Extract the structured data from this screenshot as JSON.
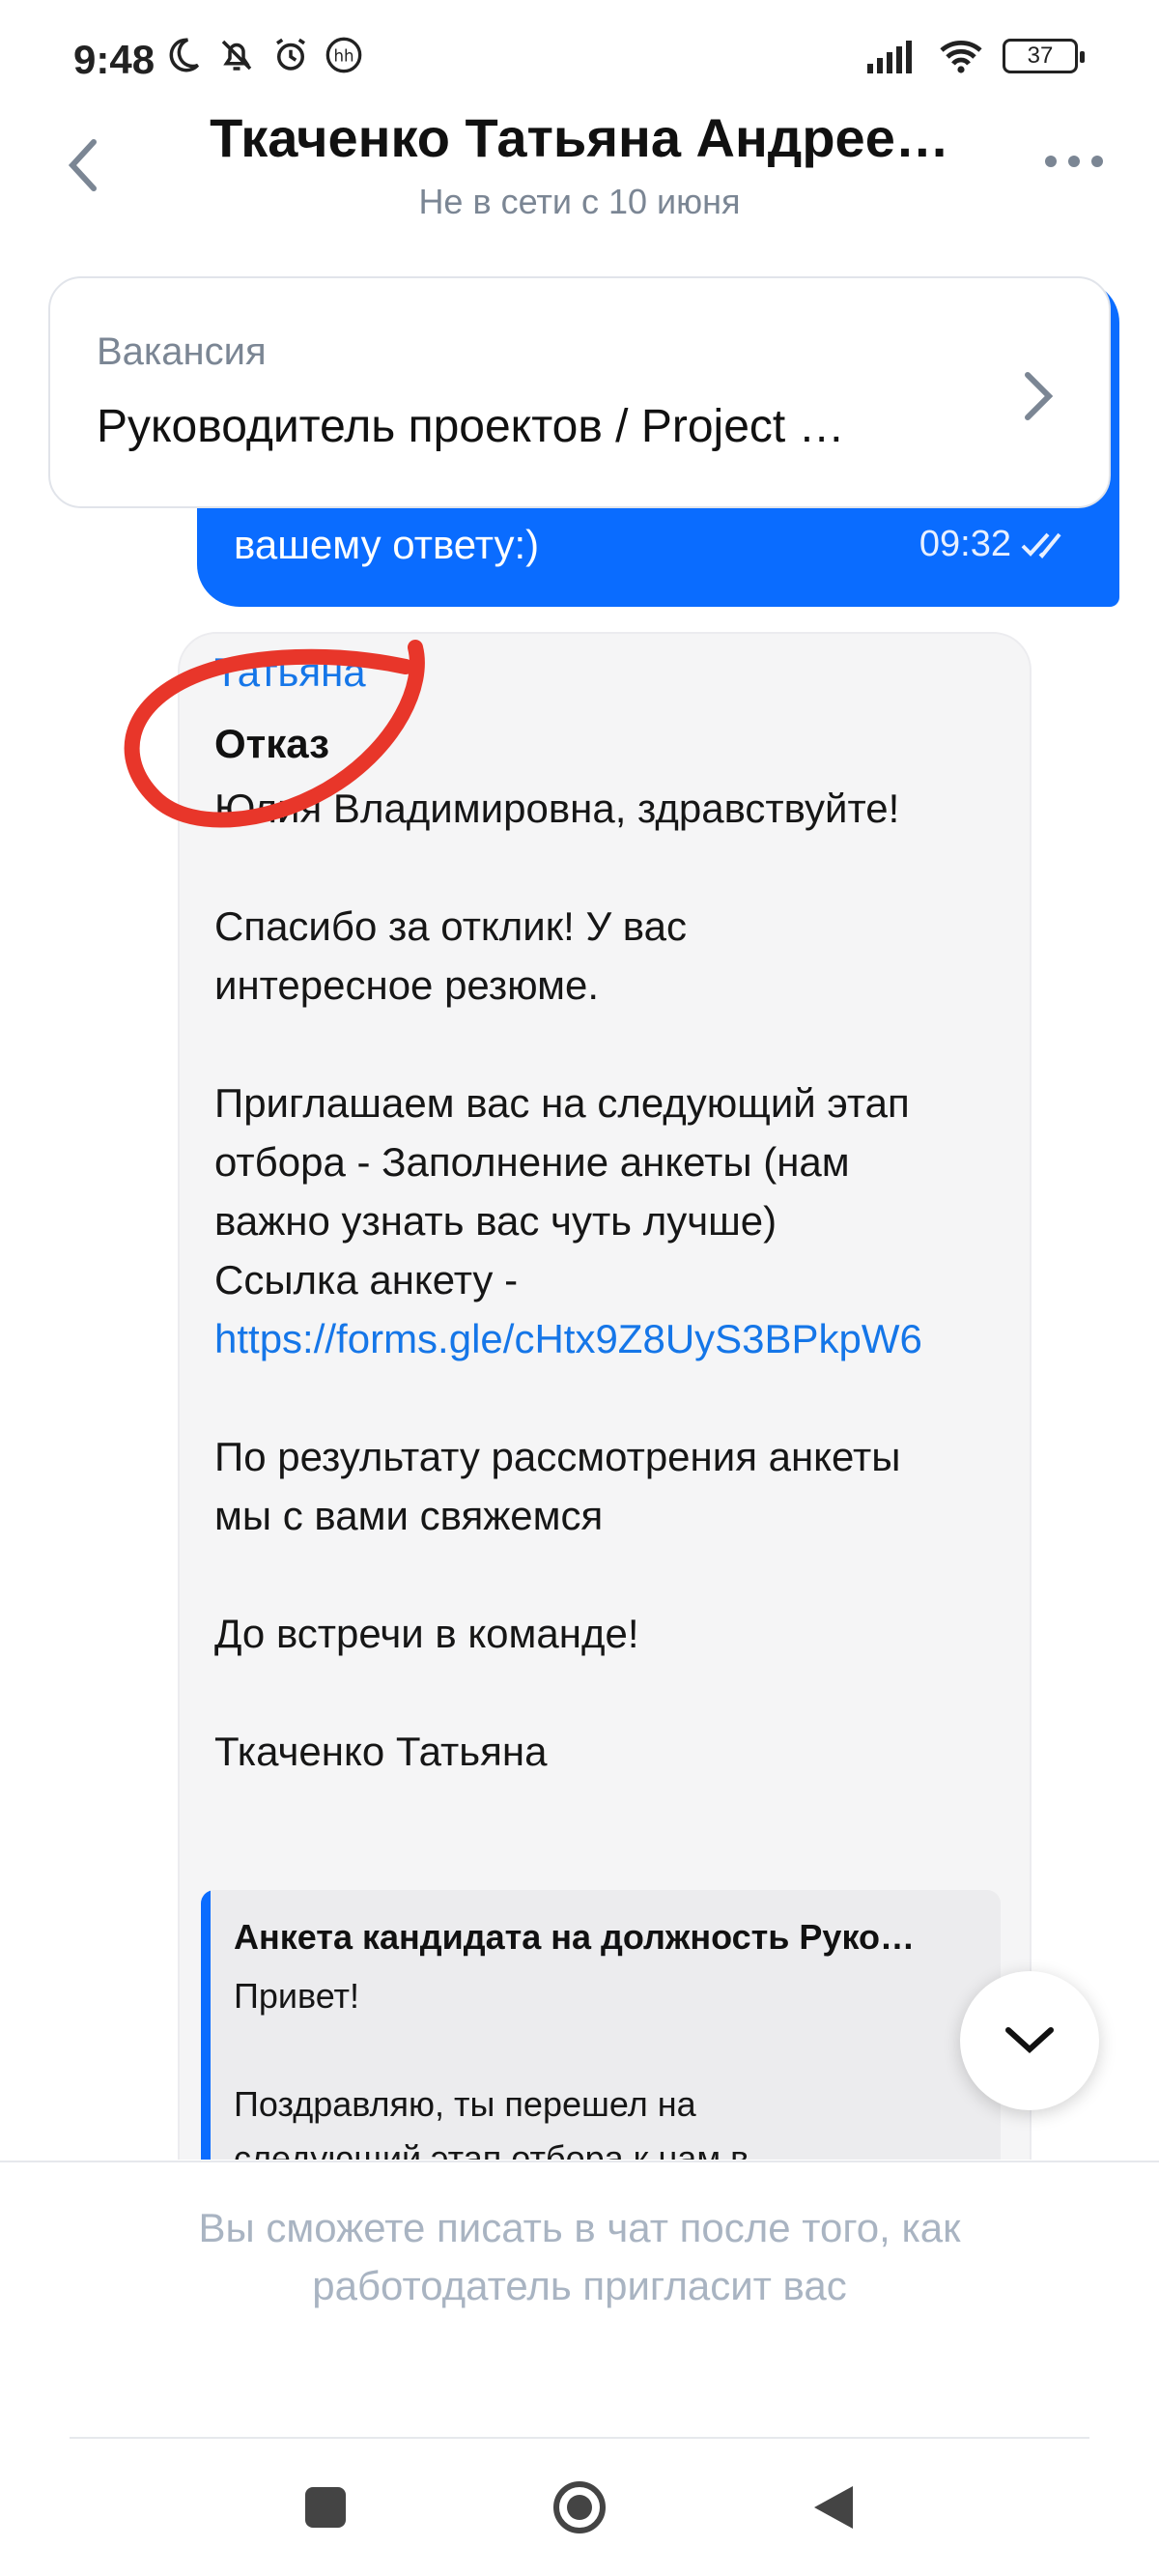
{
  "status_bar": {
    "time": "9:48",
    "battery": "37"
  },
  "header": {
    "title": "Ткаченко Татьяна Андрее…",
    "subtitle": "Не в сети с 10 июня"
  },
  "vacancy": {
    "label": "Вакансия",
    "title": "Руководитель проектов / Project …"
  },
  "outgoing_message": {
    "text": "вашему ответу:)",
    "time": "09:32"
  },
  "incoming_message": {
    "sender": "Татьяна",
    "title": "Отказ",
    "greeting": "Юлия Владимировна, здравствуйте!",
    "para1": [
      "Спасибо за отклик! У вас",
      "интересное резюме."
    ],
    "para2": [
      "Приглашаем вас на следующий этап",
      "отбора - Заполнение анкеты (нам",
      "важно узнать вас чуть лучше)",
      "Ссылка анкету -"
    ],
    "link": "https://forms.gle/cHtx9Z8UyS3BPkpW6",
    "para3": [
      "По результату рассмотрения анкеты",
      "мы с вами свяжемся"
    ],
    "para4": "До встречи в команде!",
    "signature": "Ткаченко Татьяна",
    "quote": {
      "title": "Анкета кандидата на должность Руко…",
      "line1": "Привет!",
      "line2": "Поздравляю, ты перешел на",
      "line3": "следующий этап отбора к нам в"
    }
  },
  "footer_notice": "Вы сможете писать в чат после того, как работодатель пригласит вас",
  "colors": {
    "accent": "#0a6cff",
    "link": "#1576e8",
    "annotation": "#e8362a"
  }
}
